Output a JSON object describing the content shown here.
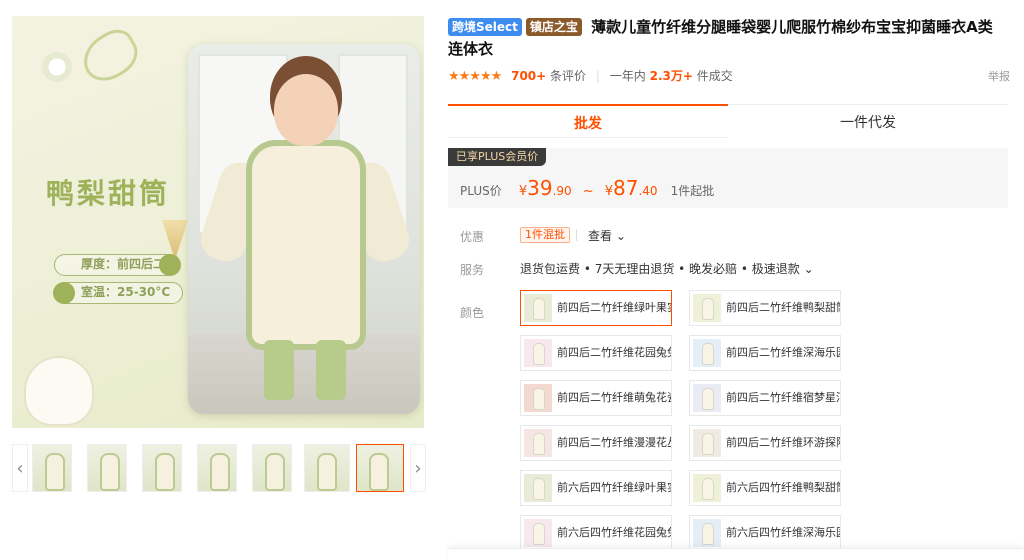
{
  "gallery": {
    "main_image": {
      "title": "鸭梨甜筒",
      "pill_1": "厚度：前四后二",
      "pill_2": "室温：25-30°C"
    },
    "thumbnails_count": 7,
    "active_thumbnail": 7,
    "prev_arrow": "‹",
    "next_arrow": "›"
  },
  "product": {
    "tags": [
      {
        "label": "跨境Select",
        "color": "#3d8cf0"
      },
      {
        "label": "镇店之宝",
        "color": "#8b5a2b"
      }
    ],
    "title": "薄款儿童竹纤维分腿睡袋婴儿爬服竹棉纱布宝宝抑菌睡衣A类连体衣",
    "stars": "★★★★★",
    "rating_value": 4.5,
    "reviews_count": "700+",
    "reviews_label": "条评价",
    "sales_prefix": "一年内",
    "sales_count": "2.3万+",
    "sales_label": "件成交",
    "report": "举报"
  },
  "tabs": [
    {
      "label": "批发",
      "active": true
    },
    {
      "label": "一件代发",
      "active": false
    }
  ],
  "price": {
    "plus_badge": "已享PLUS会员价",
    "plus_label": "PLUS价",
    "currency": "¥",
    "low_int": "39",
    "low_dec": ".90",
    "tilde": "~",
    "high_int": "87",
    "high_dec": ".40",
    "min_order": "1件起批",
    "accent_color": "#ff5000"
  },
  "offers": {
    "label": "优惠",
    "badge": "1件混批",
    "view": "查看 ⌄"
  },
  "service": {
    "label": "服务",
    "text": "退货包运费 • 7天无理由退货 • 晚发必赔 • 极速退款 ⌄"
  },
  "color": {
    "label": "颜色",
    "options": [
      {
        "name": "前四后二竹纤维绿叶果实",
        "selected": true,
        "swatch": "#e8ecd6"
      },
      {
        "name": "前四后二竹纤维鸭梨甜筒",
        "selected": false,
        "swatch": "#eef0d8"
      },
      {
        "name": "前四后二竹纤维花园兔兔",
        "selected": false,
        "swatch": "#f6e8ec"
      },
      {
        "name": "前四后二竹纤维深海乐园",
        "selected": false,
        "swatch": "#e4eef6"
      },
      {
        "name": "前四后二竹纤维萌兔花瓷",
        "selected": false,
        "swatch": "#f3d9cf"
      },
      {
        "name": "前四后二竹纤维宿梦星河",
        "selected": false,
        "swatch": "#e9ecf3"
      },
      {
        "name": "前四后二竹纤维漫漫花丛",
        "selected": false,
        "swatch": "#f5e6e4"
      },
      {
        "name": "前四后二竹纤维环游探险",
        "selected": false,
        "swatch": "#f0ebe2"
      },
      {
        "name": "前六后四竹纤维绿叶果实",
        "selected": false,
        "swatch": "#e8ecd6"
      },
      {
        "name": "前六后四竹纤维鸭梨甜筒",
        "selected": false,
        "swatch": "#eef0d8"
      },
      {
        "name": "前六后四竹纤维花园兔兔",
        "selected": false,
        "swatch": "#f6e8ec"
      },
      {
        "name": "前六后四竹纤维深海乐园",
        "selected": false,
        "swatch": "#e4eef6"
      }
    ]
  }
}
